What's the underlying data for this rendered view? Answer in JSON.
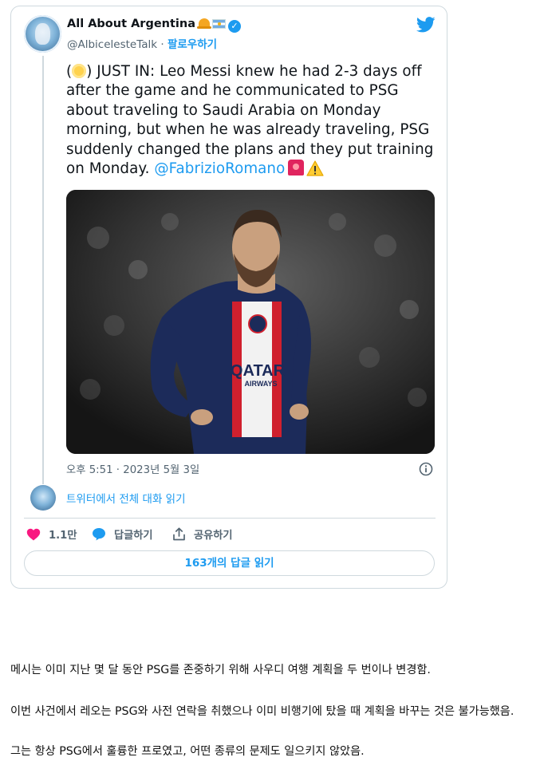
{
  "tweet": {
    "author_name": "All About Argentina",
    "handle": "@AlbicelesteTalk",
    "separator": "·",
    "follow_label": "팔로우하기",
    "text_open": "(",
    "text_main": ") JUST IN: Leo Messi knew he had 2-3 days off after the game and he communicated to PSG about traveling to Saudi Arabia on Monday morning, but when he was already traveling, PSG suddenly changed the plans and they put training on Monday. ",
    "mention": "@FabrizioRomano",
    "time": "오후 5:51",
    "date_separator": "·",
    "date": "2023년 5월 3일",
    "read_conversation_label": "트위터에서 전체 대화 읽기",
    "likes_count": "1.1만",
    "reply_label": "답글하기",
    "share_label": "공유하기",
    "read_replies_label": "163개의 답글 읽기"
  },
  "photo": {
    "jersey_sponsor_line1": "QATAR",
    "jersey_sponsor_line2": "AIRWAYS"
  },
  "body_text": [
    "메시는 이미 지난 몇 달 동안 PSG를 존중하기 위해 사우디 여행 계획을 두 번이나 변경함.",
    "이번 사건에서 레오는 PSG와 사전 연락을 취했으나 이미 비행기에 탔을 때 계획을 바꾸는 것은 불가능했음.",
    "그는 항상 PSG에서 훌륭한 프로였고, 어떤 종류의 문제도 일으키지 않았음."
  ],
  "colors": {
    "twitter_blue": "#1d9bf0",
    "like_pink": "#f91880",
    "border": "#cfd9de",
    "secondary_text": "#536471"
  },
  "icons": [
    "twitter-bird-icon",
    "verified-badge-icon",
    "bell-emoji-icon",
    "argentina-flag-icon",
    "info-icon",
    "heart-icon",
    "reply-bubble-icon",
    "share-icon",
    "siren-emoji-icon",
    "warning-emoji-icon"
  ]
}
